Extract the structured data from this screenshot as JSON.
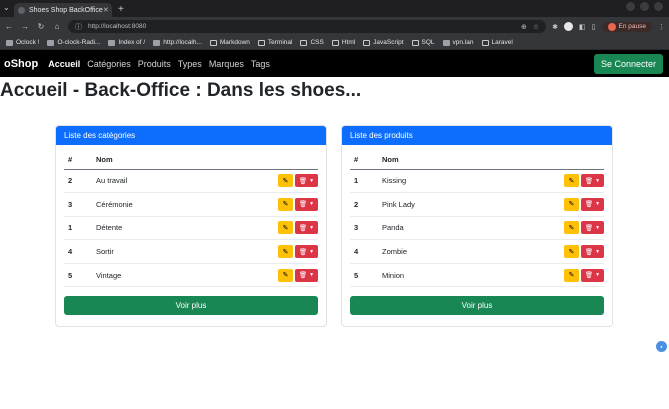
{
  "browser": {
    "tab_title": "Shoes Shop BackOffice",
    "url": "http://localhost:8080",
    "profile_status": "En pause",
    "bookmarks": [
      "Oclock !",
      "O-clock-Radi...",
      "Index of /",
      "http://localh...",
      "Markdown",
      "Terminal",
      "CSS",
      "Html",
      "JavaScript",
      "SQL",
      "vpn.lan",
      "Laravel"
    ]
  },
  "navbar": {
    "brand": "oShop",
    "links": [
      "Accueil",
      "Catégories",
      "Produits",
      "Types",
      "Marques",
      "Tags"
    ],
    "login": "Se Connecter"
  },
  "page": {
    "title_prefix": "Accueil - Back-Office : ",
    "title_bold": "Dans les shoes..."
  },
  "categories": {
    "header": "Liste des catégories",
    "col_id": "#",
    "col_name": "Nom",
    "rows": [
      {
        "id": "2",
        "name": "Au travail"
      },
      {
        "id": "3",
        "name": "Cérémonie"
      },
      {
        "id": "1",
        "name": "Détente"
      },
      {
        "id": "4",
        "name": "Sortir"
      },
      {
        "id": "5",
        "name": "Vintage"
      }
    ],
    "more": "Voir plus"
  },
  "products": {
    "header": "Liste des produits",
    "col_id": "#",
    "col_name": "Nom",
    "rows": [
      {
        "id": "1",
        "name": "Kissing"
      },
      {
        "id": "2",
        "name": "Pink Lady"
      },
      {
        "id": "3",
        "name": "Panda"
      },
      {
        "id": "4",
        "name": "Zombie"
      },
      {
        "id": "5",
        "name": "Minion"
      }
    ],
    "more": "Voir plus"
  },
  "colors": {
    "primary": "#0d6efd",
    "success": "#198754",
    "warning": "#ffc107",
    "danger": "#dc3545"
  }
}
